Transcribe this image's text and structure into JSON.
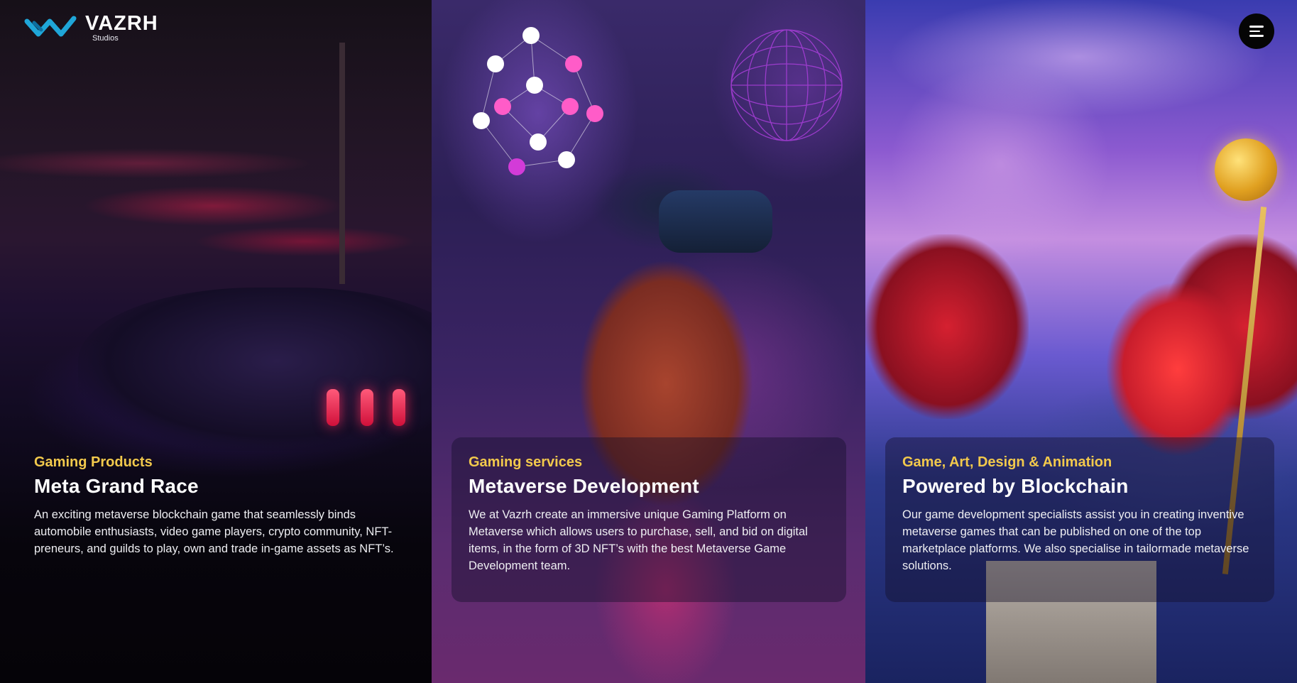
{
  "brand": {
    "name": "VAZRH",
    "subtitle": "Studios",
    "accent": "#1fa6d8"
  },
  "header": {
    "menu_icon": "hamburger-icon"
  },
  "panels": [
    {
      "eyebrow": "Gaming Products",
      "title": "Meta Grand Race",
      "description": "An exciting metaverse blockchain game that seamlessly binds automobile enthusiasts, video game players, crypto community, NFT-preneurs, and guilds to play, own and trade in-game assets as NFT’s."
    },
    {
      "eyebrow": "Gaming services",
      "title": "Metaverse Development",
      "description": "We at Vazrh create an immersive unique Gaming Platform on Metaverse which allows users to purchase, sell, and bid on digital items, in the form of 3D NFT’s with the best Metaverse Game Development team."
    },
    {
      "eyebrow": "Game, Art, Design & Animation",
      "title": "Powered by Blockchain",
      "description": "Our game development specialists assist you in creating inventive metaverse games that can be published on one of the top marketplace platforms. We also specialise in tailormade metaverse solutions."
    }
  ],
  "colors": {
    "eyebrow": "#f2c94c",
    "title": "#ffffff"
  }
}
